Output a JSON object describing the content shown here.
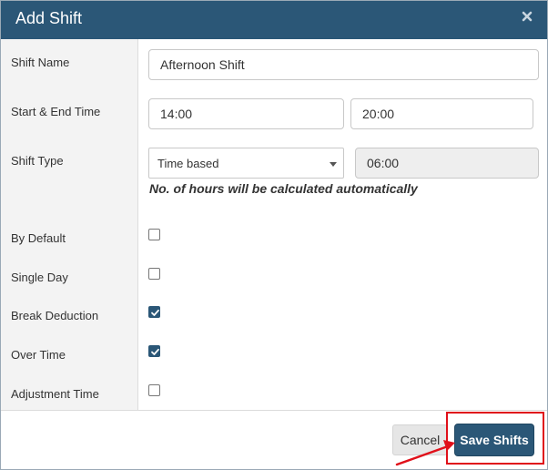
{
  "modal": {
    "title": "Add Shift",
    "close_icon": "close-icon"
  },
  "form": {
    "shift_name": {
      "label": "Shift Name",
      "value": "Afternoon Shift"
    },
    "time": {
      "label": "Start & End Time",
      "start": "14:00",
      "end": "20:00"
    },
    "shift_type": {
      "label": "Shift Type",
      "selected": "Time based",
      "hours": "06:00",
      "note": "No. of hours will be calculated automatically"
    },
    "by_default": {
      "label": "By Default",
      "checked": false
    },
    "single_day": {
      "label": "Single Day",
      "checked": false
    },
    "break_deduction": {
      "label": "Break Deduction",
      "checked": true
    },
    "over_time": {
      "label": "Over Time",
      "checked": true
    },
    "adjustment_time": {
      "label": "Adjustment Time",
      "checked": false
    }
  },
  "footer": {
    "cancel_label": "Cancel",
    "save_label": "Save Shifts"
  },
  "colors": {
    "header": "#2b5777",
    "primary_button": "#2b5777",
    "annotation": "#e0101a"
  }
}
